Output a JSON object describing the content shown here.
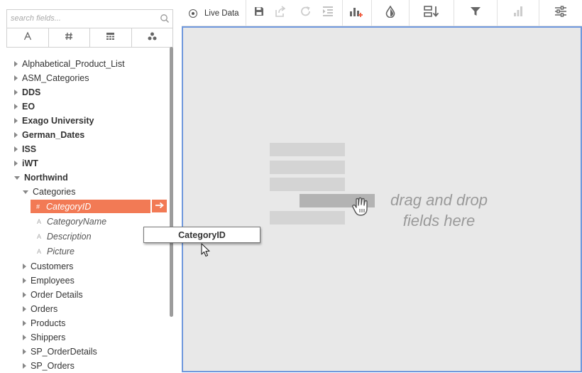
{
  "search": {
    "placeholder": "search fields..."
  },
  "type_tabs": [
    {
      "name": "text-type-tab",
      "glyph": "A"
    },
    {
      "name": "number-type-tab",
      "glyph": "#"
    },
    {
      "name": "table-type-tab",
      "glyph": "table"
    },
    {
      "name": "group-type-tab",
      "glyph": "dots"
    }
  ],
  "tree": [
    {
      "label": "Alphabetical_Product_List",
      "level": 0,
      "kind": "folder",
      "state": "collapsed",
      "bold": false
    },
    {
      "label": "ASM_Categories",
      "level": 0,
      "kind": "folder",
      "state": "collapsed",
      "bold": false
    },
    {
      "label": "DDS",
      "level": 0,
      "kind": "folder",
      "state": "collapsed",
      "bold": true
    },
    {
      "label": "EO",
      "level": 0,
      "kind": "folder",
      "state": "collapsed",
      "bold": true
    },
    {
      "label": "Exago University",
      "level": 0,
      "kind": "folder",
      "state": "collapsed",
      "bold": true
    },
    {
      "label": "German_Dates",
      "level": 0,
      "kind": "folder",
      "state": "collapsed",
      "bold": true
    },
    {
      "label": "ISS",
      "level": 0,
      "kind": "folder",
      "state": "collapsed",
      "bold": true
    },
    {
      "label": "iWT",
      "level": 0,
      "kind": "folder",
      "state": "collapsed",
      "bold": true
    },
    {
      "label": "Northwind",
      "level": 0,
      "kind": "folder",
      "state": "expanded",
      "bold": true
    },
    {
      "label": "Categories",
      "level": 1,
      "kind": "folder",
      "state": "expanded",
      "bold": false
    },
    {
      "label": "CategoryID",
      "level": 2,
      "kind": "field",
      "type_glyph": "#",
      "selected": true
    },
    {
      "label": "CategoryName",
      "level": 2,
      "kind": "field",
      "type_glyph": "A"
    },
    {
      "label": "Description",
      "level": 2,
      "kind": "field",
      "type_glyph": "A"
    },
    {
      "label": "Picture",
      "level": 2,
      "kind": "field",
      "type_glyph": "A"
    },
    {
      "label": "Customers",
      "level": 1,
      "kind": "folder",
      "state": "collapsed",
      "bold": false
    },
    {
      "label": "Employees",
      "level": 1,
      "kind": "folder",
      "state": "collapsed",
      "bold": false
    },
    {
      "label": "Order Details",
      "level": 1,
      "kind": "folder",
      "state": "collapsed",
      "bold": false
    },
    {
      "label": "Orders",
      "level": 1,
      "kind": "folder",
      "state": "collapsed",
      "bold": false
    },
    {
      "label": "Products",
      "level": 1,
      "kind": "folder",
      "state": "collapsed",
      "bold": false
    },
    {
      "label": "Shippers",
      "level": 1,
      "kind": "folder",
      "state": "collapsed",
      "bold": false
    },
    {
      "label": "SP_OrderDetails",
      "level": 1,
      "kind": "folder",
      "state": "collapsed",
      "bold": false
    },
    {
      "label": "SP_Orders",
      "level": 1,
      "kind": "folder",
      "state": "collapsed",
      "bold": false
    }
  ],
  "drag_ghost": {
    "label": "CategoryID"
  },
  "toolbar": {
    "live_data_label": "Live Data",
    "buttons": [
      "save-icon",
      "export-icon",
      "redo-icon",
      "indent-icon",
      "add-chart-icon",
      "color-drop-icon",
      "sort-icon",
      "filter-icon",
      "bar-chart-icon",
      "settings-sliders-icon"
    ]
  },
  "canvas": {
    "hint_line1": "drag and drop",
    "hint_line2": "fields here"
  },
  "colors": {
    "accent": "#f27a55",
    "canvas_border": "#6f98dd",
    "canvas_bg": "#e8e8e8"
  }
}
